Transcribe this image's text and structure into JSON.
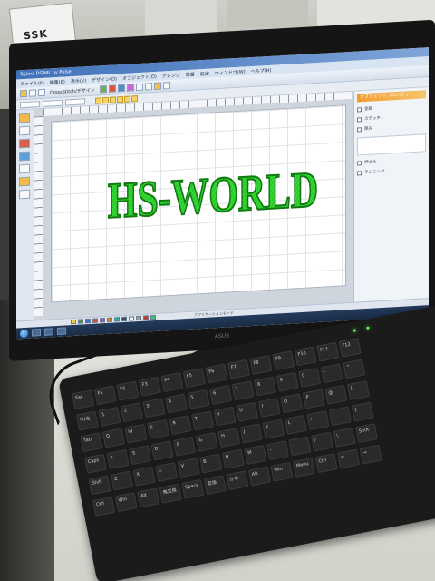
{
  "scene": {
    "box_logo": "SSK",
    "monitor_brand": "ASUS",
    "colors": {
      "embroidery_green": "#2fd42f",
      "embroidery_stroke": "#0f7a0f",
      "keyboard_led": "#5aff5a",
      "accent_orange": "#f39b2b"
    }
  },
  "app": {
    "title": "Tajima DG/ML by Pulse",
    "menu": [
      "ファイル(F)",
      "編集(E)",
      "表示(V)",
      "デザイン(D)",
      "オブジェクト(O)",
      "アレンジ",
      "階層",
      "設定",
      "ウィンドウ(W)",
      "ヘルプ(H)"
    ],
    "toolbar_label": "CrossStitch/デザイン",
    "side_panel": {
      "header": "オブジェクトプロパティ",
      "rows": [
        "全般",
        "ステッチ",
        "厚み",
        "押さえ",
        "ランニング"
      ]
    },
    "design_text": "HS-WORLD",
    "status_text": "アプリケーションモード",
    "swatches": [
      "#f2d23c",
      "#4c9a3c",
      "#3c74c8",
      "#d94a3a",
      "#9b59b6",
      "#e67e22",
      "#1abc9c",
      "#34495e",
      "#ecf0f1",
      "#95a5a6",
      "#c0392b",
      "#2ecc71"
    ]
  },
  "keyboard": {
    "rows": [
      [
        "Esc",
        "F1",
        "F2",
        "F3",
        "F4",
        "F5",
        "F6",
        "F7",
        "F8",
        "F9",
        "F10",
        "F11",
        "F12"
      ],
      [
        "半/全",
        "1",
        "2",
        "3",
        "4",
        "5",
        "6",
        "7",
        "8",
        "9",
        "0",
        "-",
        "^"
      ],
      [
        "Tab",
        "Q",
        "W",
        "E",
        "R",
        "T",
        "Y",
        "U",
        "I",
        "O",
        "P",
        "@",
        "["
      ],
      [
        "Caps",
        "A",
        "S",
        "D",
        "F",
        "G",
        "H",
        "J",
        "K",
        "L",
        ";",
        ":",
        "]"
      ],
      [
        "Shift",
        "Z",
        "X",
        "C",
        "V",
        "B",
        "N",
        "M",
        ",",
        ".",
        "/",
        "\\",
        "Shift"
      ],
      [
        "Ctrl",
        "Win",
        "Alt",
        "無変換",
        "Space",
        "変換",
        "かな",
        "Alt",
        "Win",
        "Menu",
        "Ctrl",
        "←",
        "→"
      ]
    ]
  }
}
